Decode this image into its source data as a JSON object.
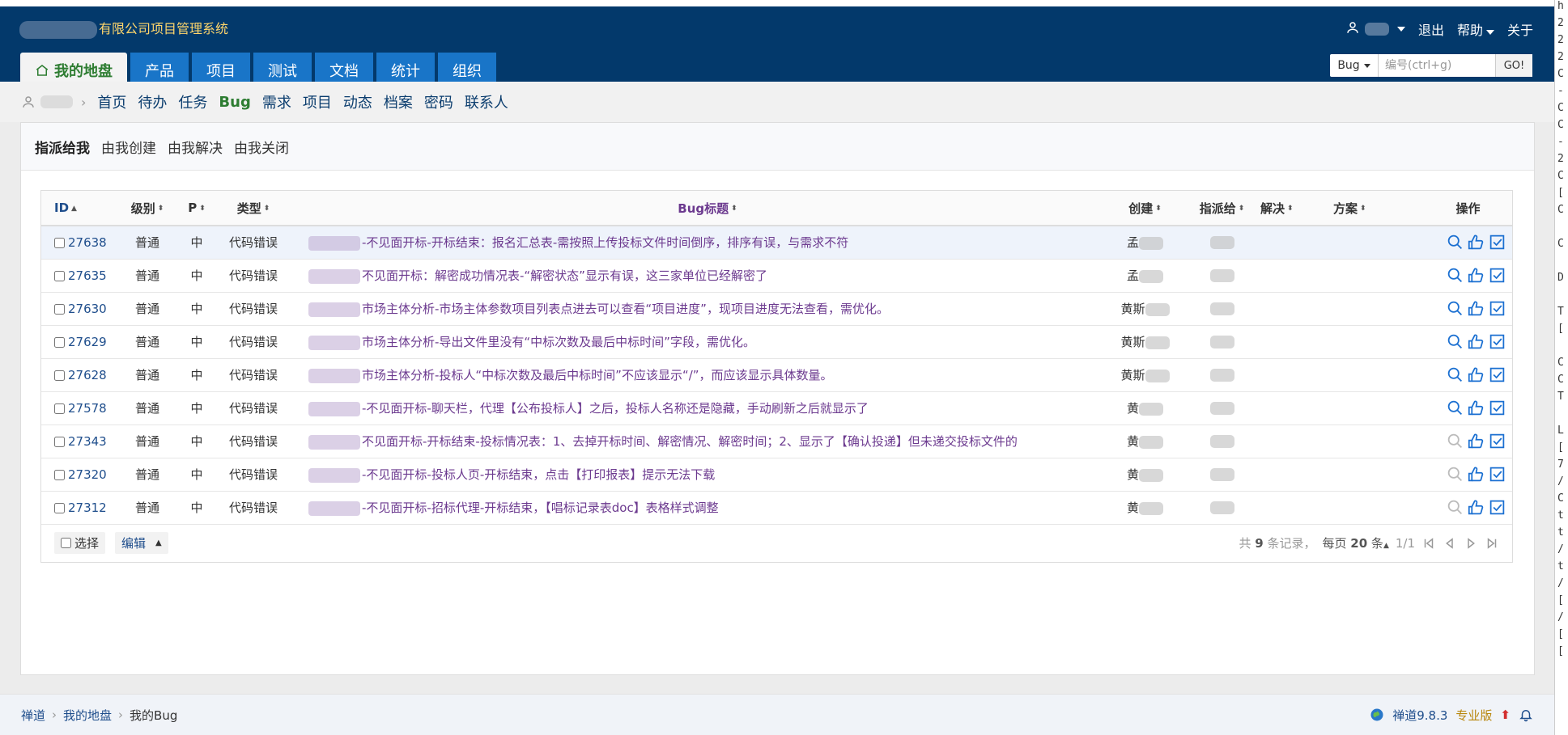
{
  "app": {
    "title_suffix": "有限公司项目管理系统"
  },
  "user_menu": {
    "logout": "退出",
    "help": "帮助",
    "about": "关于"
  },
  "nav_tabs": [
    {
      "label": "我的地盘",
      "active": true
    },
    {
      "label": "产品"
    },
    {
      "label": "项目"
    },
    {
      "label": "测试"
    },
    {
      "label": "文档"
    },
    {
      "label": "统计"
    },
    {
      "label": "组织"
    }
  ],
  "search": {
    "type": "Bug",
    "placeholder": "编号(ctrl+g)",
    "go": "GO!"
  },
  "subnav": [
    {
      "label": "首页"
    },
    {
      "label": "待办"
    },
    {
      "label": "任务"
    },
    {
      "label": "Bug",
      "active": true
    },
    {
      "label": "需求"
    },
    {
      "label": "项目"
    },
    {
      "label": "动态"
    },
    {
      "label": "档案"
    },
    {
      "label": "密码"
    },
    {
      "label": "联系人"
    }
  ],
  "feature_tabs": [
    {
      "label": "指派给我",
      "active": true
    },
    {
      "label": "由我创建"
    },
    {
      "label": "由我解决"
    },
    {
      "label": "由我关闭"
    }
  ],
  "table": {
    "headers": {
      "id": "ID",
      "severity": "级别",
      "pri": "P",
      "type": "类型",
      "title": "Bug标题",
      "opened_by": "创建",
      "assigned_to": "指派给",
      "resolved_by": "解决",
      "resolution": "方案",
      "actions": "操作"
    },
    "rows": [
      {
        "id": "27638",
        "severity": "普通",
        "pri": "中",
        "type": "代码错误",
        "title": "-不见面开标-开标结束：报名汇总表-需按照上传投标文件时间倒序，排序有误，与需求不符",
        "opened_by": "孟",
        "assigned_to": ""
      },
      {
        "id": "27635",
        "severity": "普通",
        "pri": "中",
        "type": "代码错误",
        "title": "不见面开标：解密成功情况表-“解密状态”显示有误，这三家单位已经解密了",
        "opened_by": "孟",
        "assigned_to": ""
      },
      {
        "id": "27630",
        "severity": "普通",
        "pri": "中",
        "type": "代码错误",
        "title": "市场主体分析-市场主体参数项目列表点进去可以查看“项目进度”，现项目进度无法查看，需优化。",
        "opened_by": "黄斯",
        "assigned_to": ""
      },
      {
        "id": "27629",
        "severity": "普通",
        "pri": "中",
        "type": "代码错误",
        "title": "市场主体分析-导出文件里没有“中标次数及最后中标时间”字段，需优化。",
        "opened_by": "黄斯",
        "assigned_to": ""
      },
      {
        "id": "27628",
        "severity": "普通",
        "pri": "中",
        "type": "代码错误",
        "title": "市场主体分析-投标人“中标次数及最后中标时间”不应该显示“/”，而应该显示具体数量。",
        "opened_by": "黄斯",
        "assigned_to": ""
      },
      {
        "id": "27578",
        "severity": "普通",
        "pri": "中",
        "type": "代码错误",
        "title": "-不见面开标-聊天栏，代理【公布投标人】之后，投标人名称还是隐藏，手动刷新之后就显示了",
        "opened_by": "黄",
        "assigned_to": ""
      },
      {
        "id": "27343",
        "severity": "普通",
        "pri": "中",
        "type": "代码错误",
        "title": "不见面开标-开标结束-投标情况表：1、去掉开标时间、解密情况、解密时间；2、显示了【确认投递】但未递交投标文件的",
        "opened_by": "黄",
        "assigned_to": ""
      },
      {
        "id": "27320",
        "severity": "普通",
        "pri": "中",
        "type": "代码错误",
        "title": "-不见面开标-投标人页-开标结束，点击【打印报表】提示无法下载",
        "opened_by": "黄",
        "assigned_to": ""
      },
      {
        "id": "27312",
        "severity": "普通",
        "pri": "中",
        "type": "代码错误",
        "title": "-不见面开标-招标代理-开标结束，【唱标记录表doc】表格样式调整",
        "opened_by": "黄",
        "assigned_to": ""
      }
    ]
  },
  "footer_bar": {
    "select_label": "选择",
    "edit_label": "编辑",
    "total_prefix": "共",
    "total": "9",
    "total_suffix": "条记录，",
    "per_page_prefix": "每页",
    "per_page": "20",
    "per_page_suffix": "条",
    "page": "1/1"
  },
  "breadcrumb": {
    "root": "禅道",
    "mid": "我的地盘",
    "current": "我的Bug"
  },
  "version": {
    "name": "禅道9.8.3",
    "edition": "专业版"
  },
  "right_strip": [
    "h",
    "2",
    "2",
    "2",
    "C",
    "-",
    "C",
    "C",
    "-",
    "2",
    "C",
    "[",
    "C",
    "",
    "C",
    "",
    "D",
    "",
    "T",
    "[",
    "",
    "C",
    "C",
    "T",
    "",
    "L",
    "[",
    "7",
    "/",
    "C",
    "t",
    "t",
    "/",
    "t",
    "/",
    "[",
    "/",
    "[",
    "["
  ],
  "colors": {
    "header": "#03396b",
    "tab": "#1975c8",
    "active_green": "#2e7d32",
    "title_purple": "#6c3a8f",
    "action_blue": "#1a6fd1"
  }
}
